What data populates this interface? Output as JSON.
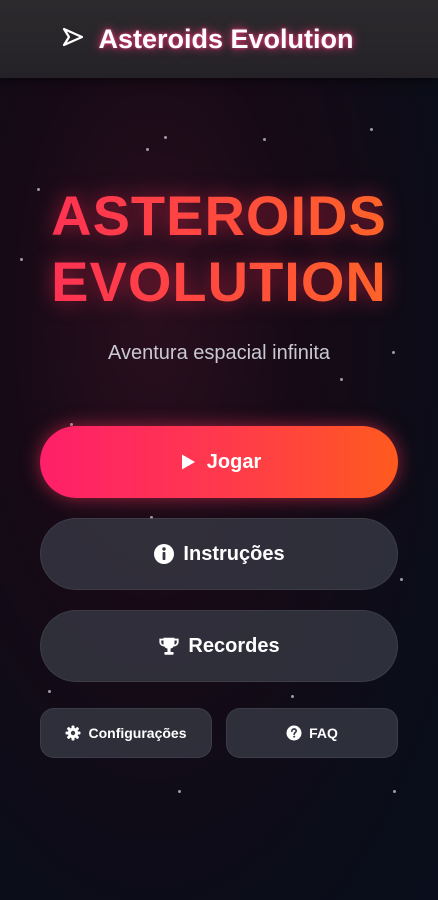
{
  "header": {
    "title": "Asteroids Evolution",
    "icon": "spaceship-icon"
  },
  "hero": {
    "line1": "ASTEROIDS",
    "line2": "EVOLUTION",
    "subtitle": "Aventura espacial infinita"
  },
  "buttons": {
    "play": {
      "label": "Jogar",
      "icon": "play-icon"
    },
    "instructions": {
      "label": "Instruções",
      "icon": "info-icon"
    },
    "records": {
      "label": "Recordes",
      "icon": "trophy-icon"
    },
    "settings": {
      "label": "Configurações",
      "icon": "gear-icon"
    },
    "faq": {
      "label": "FAQ",
      "icon": "question-icon"
    }
  },
  "colors": {
    "accent_start": "#ff1f6a",
    "accent_end": "#ff5a1e",
    "title_glow": "#ff3c82",
    "button_dark": "#3a3d48"
  }
}
